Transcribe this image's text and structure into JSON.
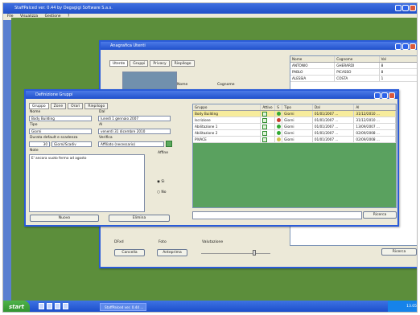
{
  "app_title": "StaffPalced ver. 0.44 by Degagigi Software S.a.s.",
  "menu": [
    "File",
    "Visualizza",
    "Gestione",
    "?"
  ],
  "anagrafica": {
    "title": "Anagrafica Utenti",
    "tabs": [
      "Utente",
      "Gruppi",
      "Privacy",
      "Riepilogo"
    ],
    "fields": {
      "name": "Nome",
      "surname": "Cognome",
      "dfixd": "DFxd",
      "photo": "Foto",
      "valuation": "Valutazione"
    },
    "buttons": {
      "cancel": "Cancella",
      "preview": "Anteprima",
      "search": "Ricerca"
    },
    "list_headers": [
      "Nome",
      "Cognome",
      "Val"
    ],
    "rows": [
      [
        "ANTONIO",
        "GHERARDI",
        "8"
      ],
      [
        "PABLO",
        "PICASSO",
        "8"
      ],
      [
        "ALESSIA",
        "COSTA",
        "1"
      ]
    ]
  },
  "gruppi": {
    "title": "Definizione Gruppi",
    "tabs": [
      "Gruppo",
      "Zone",
      "Orari",
      "Riepilogo"
    ],
    "labels": {
      "name": "Nome",
      "tipo": "Tipo",
      "durata": "Durata default e scadenza",
      "note": "Note",
      "dal": "Dal",
      "al": "Al",
      "verifica": "Verifica",
      "affine": "Affine"
    },
    "values": {
      "name": "Body Building",
      "tipo": "Giorni",
      "durata_num": "30",
      "durata_unit": "Giorni/Scadiv",
      "note": "E' ancora vuoto fermo ad agosto",
      "dal": "lunedì   1  gennaio  2007",
      "al": "venerdì  31  dicembre  2010",
      "verifica": "Affiliato (necessario)"
    },
    "radio": [
      "Sì",
      "No"
    ],
    "buttons": {
      "new": "Nuovo",
      "delete": "Elimina",
      "search": "Ricerca"
    },
    "headers": [
      "Gruppo",
      "Attivo",
      "S",
      "Tipo",
      "Dal",
      "Al"
    ],
    "rows": [
      {
        "group": "Body Building",
        "type": "Giorni",
        "from": "01/01/2007 ...",
        "to": "31/12/2010 ...",
        "color": "#31a933",
        "selected": true
      },
      {
        "group": "Iscrizione",
        "type": "Giorni",
        "from": "01/01/2007 ...",
        "to": "31/12/2010 ...",
        "color": "#c93d2e",
        "selected": false
      },
      {
        "group": "Abilitazione 1",
        "type": "Giorni",
        "from": "01/01/2007 ...",
        "to": "13/09/2007 ...",
        "color": "#31a933",
        "selected": false
      },
      {
        "group": "Abilitazione 2",
        "type": "Giorni",
        "from": "01/01/2007 ...",
        "to": "02/09/2008 ...",
        "color": "#31a933",
        "selected": false
      },
      {
        "group": "PIVACE",
        "type": "Giorni",
        "from": "01/01/2007 ...",
        "to": "02/09/2008 ...",
        "color": "#d2c24a",
        "selected": false
      }
    ]
  },
  "taskbar": {
    "start": "start",
    "window": "StaffPalced ver. 0.44 ...",
    "clock": "13.05"
  },
  "colors": {
    "taskbar": "#1f55d6",
    "desktop": "#5c8e3b",
    "grid_bg": "#5aa15f"
  }
}
